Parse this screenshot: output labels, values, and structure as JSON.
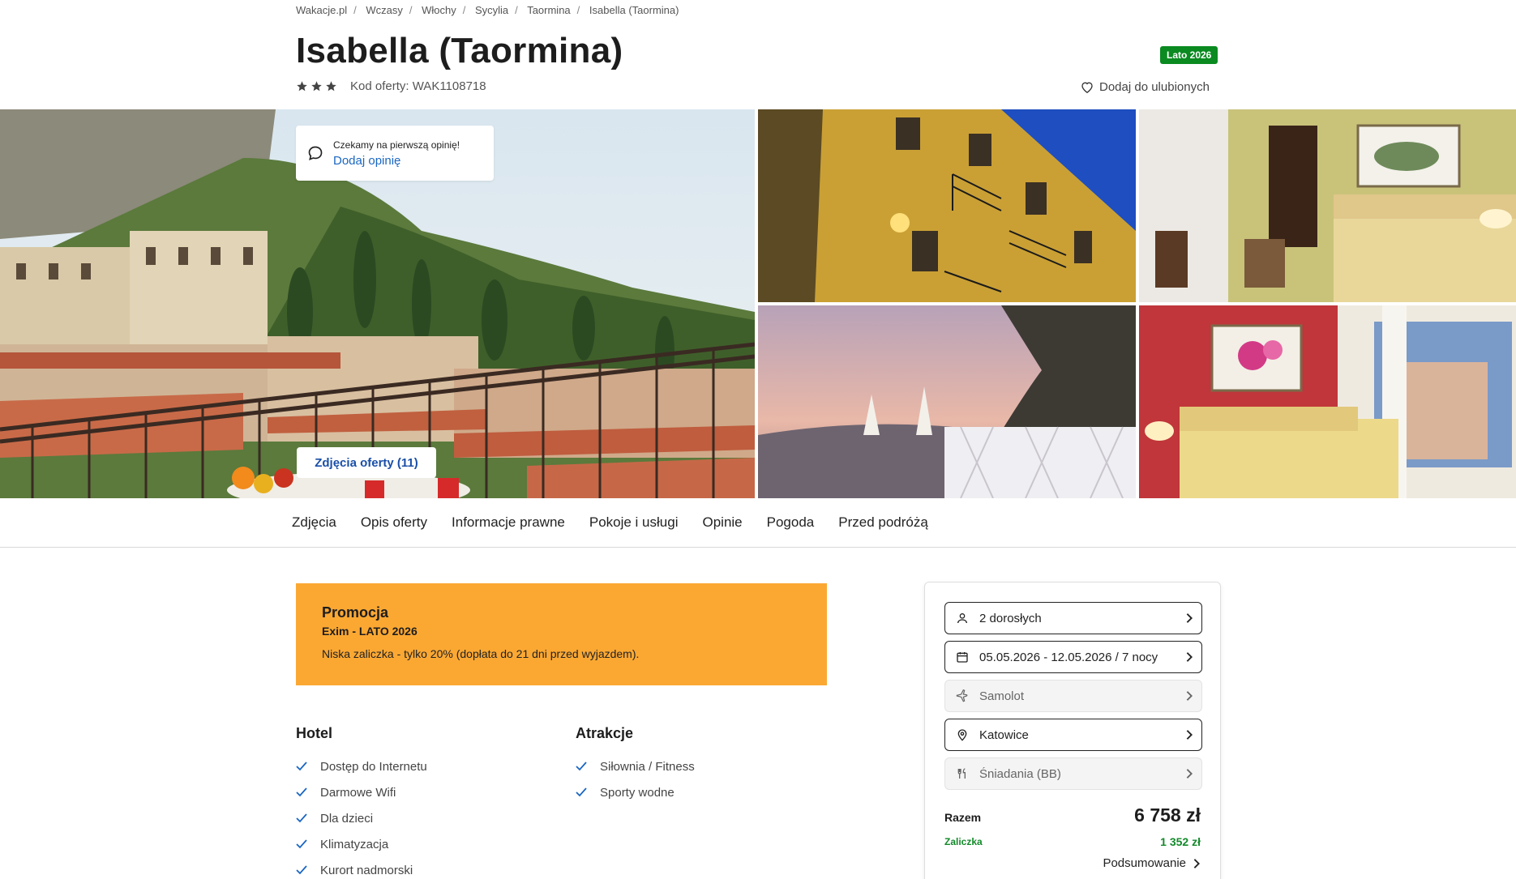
{
  "breadcrumb": [
    "Wakacje.pl",
    "Wczasy",
    "Włochy",
    "Sycylia",
    "Taormina",
    "Isabella (Taormina)"
  ],
  "hotel": {
    "title": "Isabella (Taormina)",
    "season_badge": "Lato 2026",
    "star_count": 3,
    "offer_code": "Kod oferty: WAK1108718",
    "favorite": "Dodaj do ulubionych"
  },
  "reviews": {
    "waiting": "Czekamy na pierwszą opinię!",
    "add": "Dodaj opinię"
  },
  "gallery": {
    "photos_button": "Zdjęcia oferty (11)"
  },
  "tabs": [
    "Zdjęcia",
    "Opis oferty",
    "Informacje prawne",
    "Pokoje i usługi",
    "Opinie",
    "Pogoda",
    "Przed podróżą"
  ],
  "promo": {
    "title": "Promocja",
    "subtitle": "Exim - LATO 2026",
    "description": "Niska zaliczka - tylko 20% (dopłata do 21 dni przed wyjazdem)."
  },
  "features": {
    "hotel": {
      "title": "Hotel",
      "items": [
        "Dostęp do Internetu",
        "Darmowe Wifi",
        "Dla dzieci",
        "Klimatyzacja",
        "Kurort nadmorski"
      ]
    },
    "attractions": {
      "title": "Atrakcje",
      "items": [
        "Siłownia / Fitness",
        "Sporty wodne"
      ]
    }
  },
  "booking": {
    "options": [
      {
        "label": "2 dorosłych",
        "icon": "person-icon",
        "enabled": true
      },
      {
        "label": "05.05.2026 - 12.05.2026 / 7 nocy",
        "icon": "calendar-icon",
        "enabled": true
      },
      {
        "label": "Samolot",
        "icon": "plane-icon",
        "enabled": false
      },
      {
        "label": "Katowice",
        "icon": "location-pin-icon",
        "enabled": true
      },
      {
        "label": "Śniadania (BB)",
        "icon": "fork-knife-icon",
        "enabled": false
      }
    ],
    "total_label": "Razem",
    "total_value": "6 758 zł",
    "deposit_label": "Zaliczka",
    "deposit_value": "1 352 zł",
    "summary": "Podsumowanie"
  },
  "colors": {
    "accent_blue": "#1a66c2",
    "badge_green": "#0a8a20",
    "promo_orange": "#fba833",
    "deposit_green": "#138a2a"
  }
}
